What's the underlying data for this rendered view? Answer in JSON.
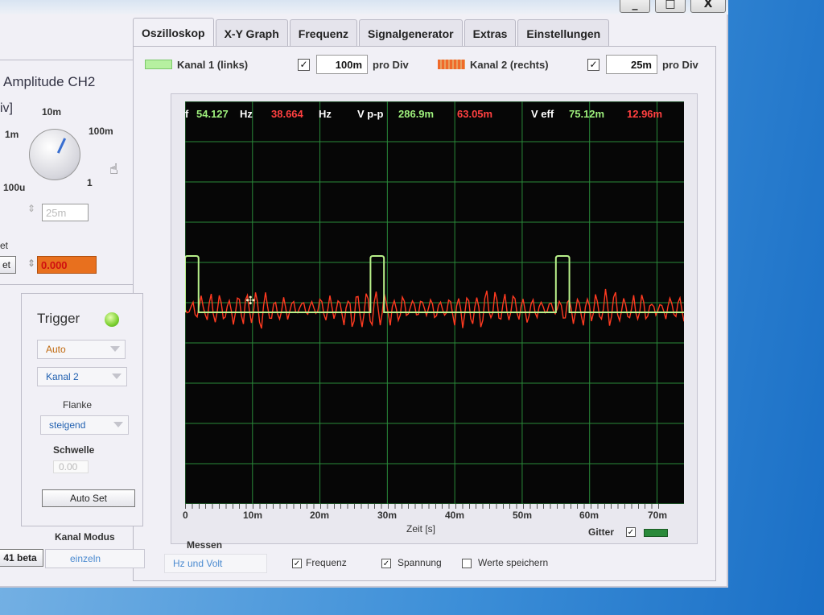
{
  "window": {
    "buttons": {
      "minimize": "_",
      "maximize": "□",
      "close": "X"
    }
  },
  "tabs": [
    {
      "label": "Oszilloskop",
      "active": true
    },
    {
      "label": "X-Y Graph"
    },
    {
      "label": "Frequenz"
    },
    {
      "label": "Signalgenerator"
    },
    {
      "label": "Extras"
    },
    {
      "label": "Einstellungen"
    }
  ],
  "channels": {
    "ch1": {
      "label": "Kanal 1 (links)",
      "checked": "✓",
      "scale": "100m",
      "unit": "pro Div",
      "color": "#8ee07a"
    },
    "ch2": {
      "label": "Kanal 2 (rechts)",
      "checked": "✓",
      "scale": "25m",
      "unit": "pro Div",
      "color": "#f06a2a"
    }
  },
  "amplitude": {
    "title": "Amplitude CH2",
    "unit_partial": "iv]",
    "knob_labels": {
      "a": "10m",
      "b": "1m",
      "c": "100m",
      "d": "100u",
      "e": "1"
    },
    "value": "25m",
    "offset_label_top": "et",
    "offset_label": "et",
    "offset_value": "0.000"
  },
  "trigger": {
    "title": "Trigger",
    "mode": "Auto",
    "source": "Kanal 2",
    "edge_label": "Flanke",
    "edge": "steigend",
    "threshold_label": "Schwelle",
    "threshold_value": "0.00",
    "auto_set": "Auto Set"
  },
  "kanal_modus": {
    "label": "Kanal Modus",
    "value": "einzeln",
    "version": "41 beta"
  },
  "measure": {
    "label": "Messen",
    "mode": "Hz und Volt",
    "frequency_cb": "✓",
    "frequency": "Frequenz",
    "voltage_cb": "✓",
    "voltage": "Spannung",
    "save_cb": "",
    "save": "Werte speichern"
  },
  "readouts": {
    "f_label": "f",
    "f_ch1": "54.127",
    "f_unit1": "Hz",
    "f_ch2": "38.664",
    "f_unit2": "Hz",
    "vpp_label": "V p-p",
    "vpp_ch1": "286.9m",
    "vpp_ch2": "63.05m",
    "veff_label": "V eff",
    "veff_ch1": "75.12m",
    "veff_ch2": "12.96m"
  },
  "axis": {
    "xlabel": "Zeit [s]",
    "ticks": [
      "0",
      "10m",
      "20m",
      "30m",
      "40m",
      "50m",
      "60m",
      "70m"
    ],
    "grid_label": "Gitter",
    "grid_cb": "✓",
    "grid_color": "#2a8a3a"
  },
  "chart_data": {
    "type": "line",
    "x_range_ms": [
      0,
      74
    ],
    "series": [
      {
        "name": "Kanal 1 (links)",
        "color": "#b8f08a",
        "pulses_ms": [
          [
            0,
            2
          ],
          [
            27.5,
            29.5
          ],
          [
            55,
            57
          ]
        ],
        "pulse_height": 1.25,
        "baseline": 0
      },
      {
        "name": "Kanal 2 (rechts)",
        "color": "#ff3a20",
        "type": "noise",
        "baseline": 0
      }
    ],
    "grid": true
  }
}
